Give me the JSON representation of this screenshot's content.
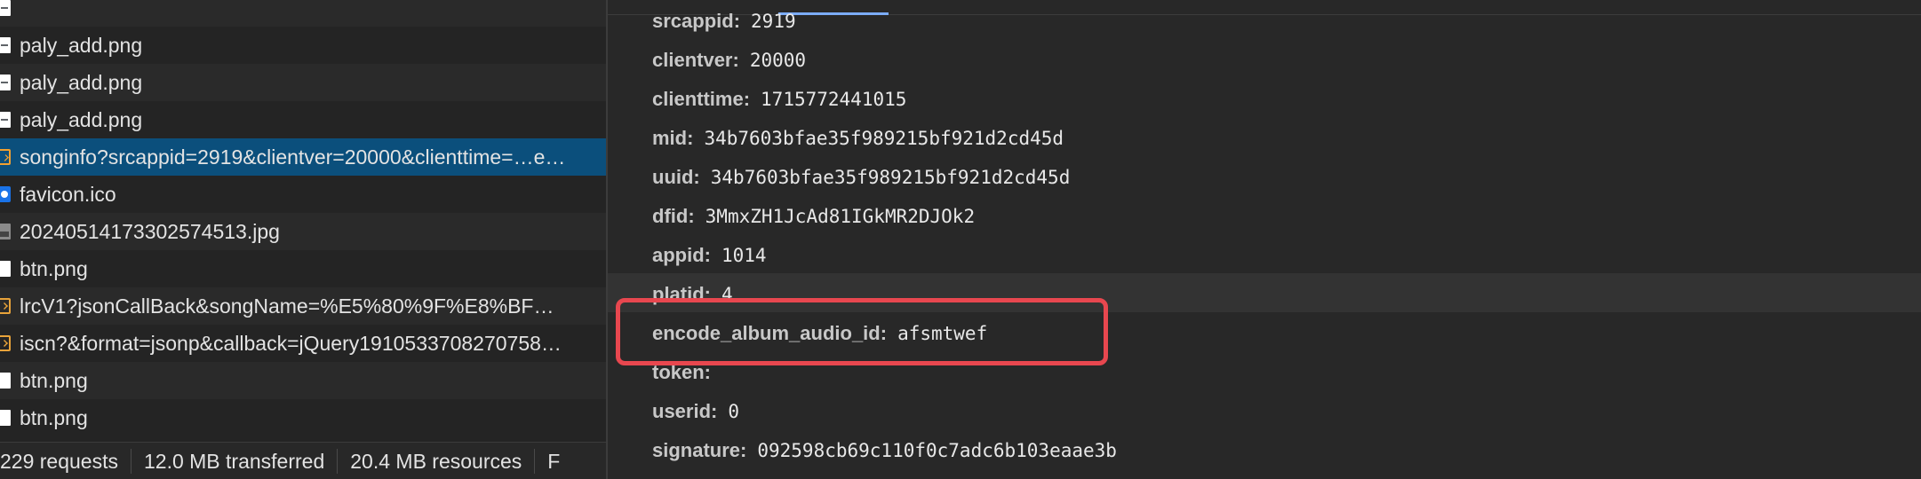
{
  "requests": [
    {
      "name": "",
      "icon": "image-file-icon"
    },
    {
      "name": "paly_add.png",
      "icon": "image-file-icon"
    },
    {
      "name": "paly_add.png",
      "icon": "image-file-icon"
    },
    {
      "name": "paly_add.png",
      "icon": "image-file-icon"
    },
    {
      "name": "songinfo?srcappid=2919&clientver=20000&clienttime=…e…",
      "icon": "json-file-icon",
      "selected": true
    },
    {
      "name": "favicon.ico",
      "icon": "favicon-icon"
    },
    {
      "name": "20240514173302574513.jpg",
      "icon": "photo-file-icon"
    },
    {
      "name": "btn.png",
      "icon": "blank-file-icon"
    },
    {
      "name": "lrcV1?jsonCallBack&songName=%E5%80%9F%E8%BF…",
      "icon": "script-file-icon"
    },
    {
      "name": "iscn?&format=jsonp&callback=jQuery1910533708270758…",
      "icon": "script-file-icon"
    },
    {
      "name": "btn.png",
      "icon": "blank-file-icon"
    },
    {
      "name": "btn.png",
      "icon": "blank-file-icon"
    }
  ],
  "status": {
    "requests": "229 requests",
    "transferred": "12.0 MB transferred",
    "resources": "20.4 MB resources",
    "finish": "F"
  },
  "params": [
    {
      "key": "srcappid:",
      "value": "2919"
    },
    {
      "key": "clientver:",
      "value": "20000"
    },
    {
      "key": "clienttime:",
      "value": "1715772441015"
    },
    {
      "key": "mid:",
      "value": "34b7603bfae35f989215bf921d2cd45d"
    },
    {
      "key": "uuid:",
      "value": "34b7603bfae35f989215bf921d2cd45d"
    },
    {
      "key": "dfid:",
      "value": "3MmxZH1JcAd81IGkMR2DJOk2"
    },
    {
      "key": "appid:",
      "value": "1014"
    },
    {
      "key": "platid:",
      "value": "4"
    },
    {
      "key": "encode_album_audio_id:",
      "value": "afsmtwef"
    },
    {
      "key": "token:",
      "value": ""
    },
    {
      "key": "userid:",
      "value": "0"
    },
    {
      "key": "signature:",
      "value": "092598cb69c110f0c7adc6b103eaae3b"
    }
  ],
  "colors": {
    "selection": "#0b4f7c",
    "highlight_box": "#e8474f",
    "tab_underline": "#7cacf8"
  }
}
